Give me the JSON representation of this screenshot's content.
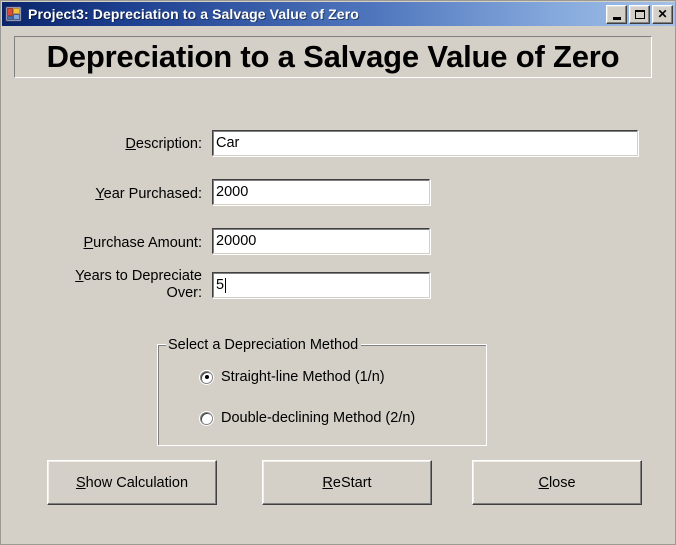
{
  "window": {
    "title": "Project3: Depreciation to a Salvage Value of Zero",
    "icon": "application-form-icon",
    "controls": {
      "minimize": "Minimize",
      "maximize": "Maximize",
      "close": "Close"
    }
  },
  "heading": {
    "text": "Depreciation to a Salvage Value of Zero"
  },
  "form": {
    "fields": [
      {
        "label_prefix": "",
        "label_acc": "D",
        "label_suffix": "escription:",
        "value": "Car",
        "has_caret": false
      },
      {
        "label_prefix": "",
        "label_acc": "Y",
        "label_suffix": "ear Purchased:",
        "value": "2000",
        "has_caret": false
      },
      {
        "label_prefix": "",
        "label_acc": "P",
        "label_suffix": "urchase Amount:",
        "value": "20000",
        "has_caret": false
      },
      {
        "label_prefix": "",
        "label_acc": "Y",
        "label_suffix": "ears to Depreciate Over:",
        "value": "5",
        "has_caret": true
      }
    ]
  },
  "groupbox": {
    "legend": "Select a Depreciation Method",
    "options": [
      {
        "label": "Straight-line Method (1/n)",
        "selected": true
      },
      {
        "label": "Double-declining Method (2/n)",
        "selected": false
      }
    ]
  },
  "buttons": [
    {
      "acc": "S",
      "rest": "how Calculation"
    },
    {
      "acc": "R",
      "rest": "e",
      "tail_acc": "",
      "rest2": "Start"
    },
    {
      "acc": "C",
      "rest": "lose"
    }
  ],
  "button_labels": {
    "show_calculation": "Show Calculation",
    "restart": "ReStart",
    "close": "Close"
  },
  "colors": {
    "face": "#d4d0c8",
    "title_start": "#0a246a",
    "title_end": "#a3c1e8",
    "field_bg": "#ffffff",
    "text": "#000000"
  }
}
